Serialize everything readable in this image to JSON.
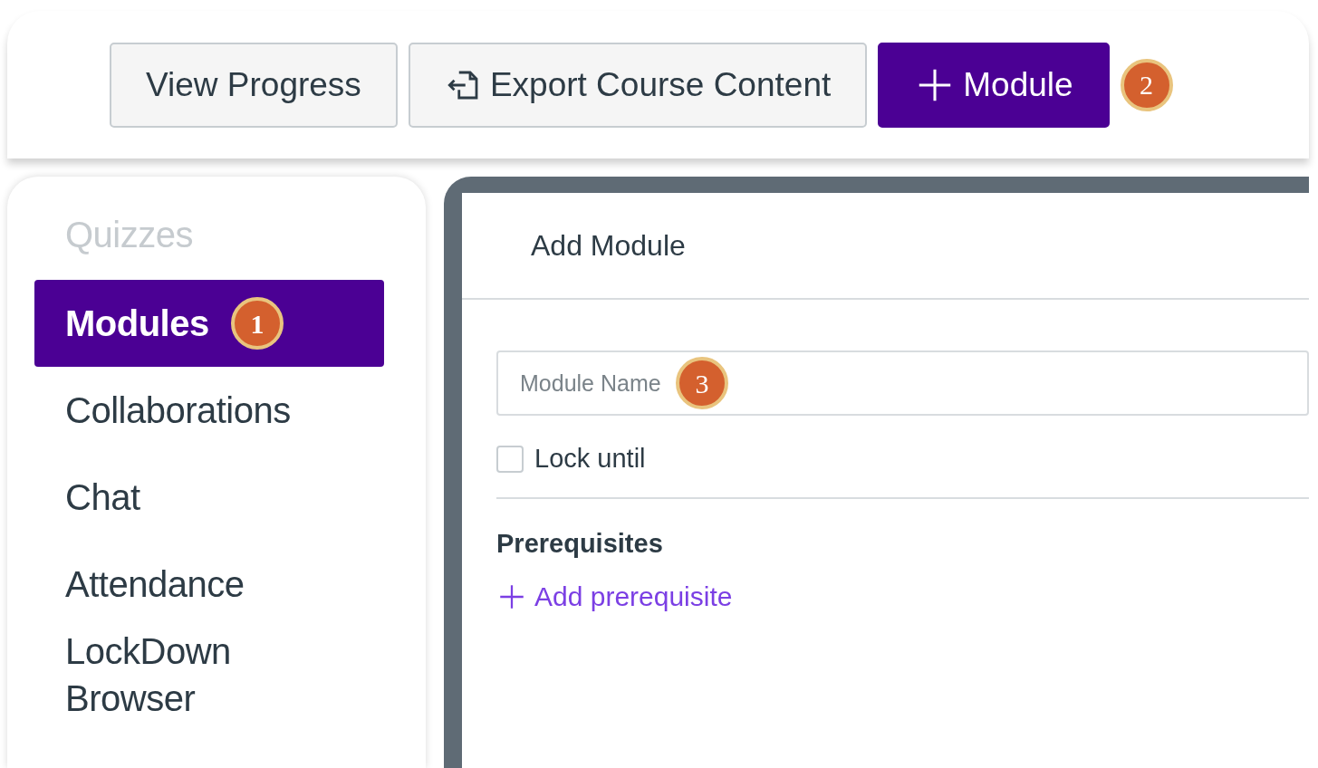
{
  "toolbar": {
    "buttons": [
      {
        "label": "View Progress",
        "kind": "plain"
      },
      {
        "label": "Export Course Content",
        "kind": "export"
      },
      {
        "label": "Module",
        "kind": "add",
        "callout": "2"
      }
    ]
  },
  "sidebar": {
    "items": [
      {
        "label": "Quizzes",
        "disabled": true,
        "selected": false
      },
      {
        "label": "Modules",
        "disabled": false,
        "selected": true,
        "callout": "1"
      },
      {
        "label": "Collaborations",
        "disabled": false,
        "selected": false
      },
      {
        "label": "Chat",
        "disabled": false,
        "selected": false
      },
      {
        "label": "Attendance",
        "disabled": false,
        "selected": false
      },
      {
        "label": "LockDown Browser",
        "disabled": false,
        "selected": false
      }
    ]
  },
  "dialog": {
    "title": "Add Module",
    "name_field": {
      "placeholder": "Module Name",
      "callout": "3"
    },
    "lock": {
      "label": "Lock until",
      "checked": false
    },
    "prerequisites": {
      "heading": "Prerequisites",
      "link": "Add prerequisite"
    }
  }
}
